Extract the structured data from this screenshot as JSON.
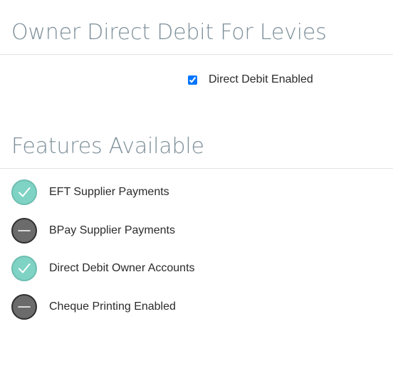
{
  "owner_direct_debit": {
    "title": "Owner Direct Debit For Levies",
    "checkbox_label": "Direct Debit Enabled",
    "checked": true
  },
  "features": {
    "title": "Features Available",
    "items": [
      {
        "label": "EFT Supplier Payments",
        "enabled": true,
        "icon": "check-circle-icon"
      },
      {
        "label": "BPay Supplier Payments",
        "enabled": false,
        "icon": "minus-circle-icon"
      },
      {
        "label": "Direct Debit Owner Accounts",
        "enabled": true,
        "icon": "check-circle-icon"
      },
      {
        "label": "Cheque Printing Enabled",
        "enabled": false,
        "icon": "minus-circle-icon"
      }
    ]
  },
  "colors": {
    "heading": "#7d8f99",
    "enabled_badge": "#7fd3c5",
    "disabled_badge": "#6b6b6b"
  }
}
